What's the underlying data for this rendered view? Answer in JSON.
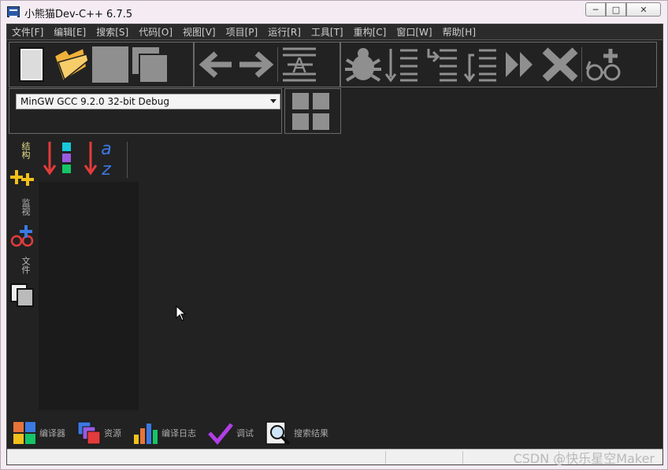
{
  "window": {
    "title": "小熊猫Dev-C++ 6.7.5",
    "caption_minimize": "─",
    "caption_maximize": "□",
    "caption_close": "✕"
  },
  "menubar": {
    "items": [
      {
        "label": "文件[F]"
      },
      {
        "label": "编辑[E]"
      },
      {
        "label": "搜索[S]"
      },
      {
        "label": "代码[O]"
      },
      {
        "label": "视图[V]"
      },
      {
        "label": "项目[P]"
      },
      {
        "label": "运行[R]"
      },
      {
        "label": "工具[T]"
      },
      {
        "label": "重构[C]"
      },
      {
        "label": "窗口[W]"
      },
      {
        "label": "帮助[H]"
      }
    ]
  },
  "toolbar": {
    "file_icons": [
      "new-file-icon",
      "open-folder-icon",
      "save-icon",
      "save-all-icon"
    ],
    "nav_icons": [
      "back-arrow-icon",
      "forward-arrow-icon",
      "format-icon"
    ],
    "debug_icons": [
      "bug-icon",
      "step-into-icon",
      "step-out-icon",
      "step-over-icon",
      "continue-icon",
      "stop-icon",
      "watch-add-icon"
    ]
  },
  "compiler": {
    "selected": "MinGW GCC 9.2.0 32-bit Debug"
  },
  "side_tabs": {
    "structure": "结构",
    "watch": "监视",
    "files": "文件"
  },
  "bottom_tabs": [
    {
      "label": "编译器",
      "icon": "grid-icon"
    },
    {
      "label": "资源",
      "icon": "resource-icon"
    },
    {
      "label": "编译日志",
      "icon": "bar-chart-icon"
    },
    {
      "label": "调试",
      "icon": "check-icon"
    },
    {
      "label": "搜索结果",
      "icon": "magnifier-icon"
    }
  ],
  "watermark": "CSDN @快乐星空Maker",
  "colors": {
    "client_bg": "#222222",
    "accent_yellow": "#f2c01b",
    "accent_red": "#e33b3b",
    "accent_blue": "#3b79e3"
  }
}
